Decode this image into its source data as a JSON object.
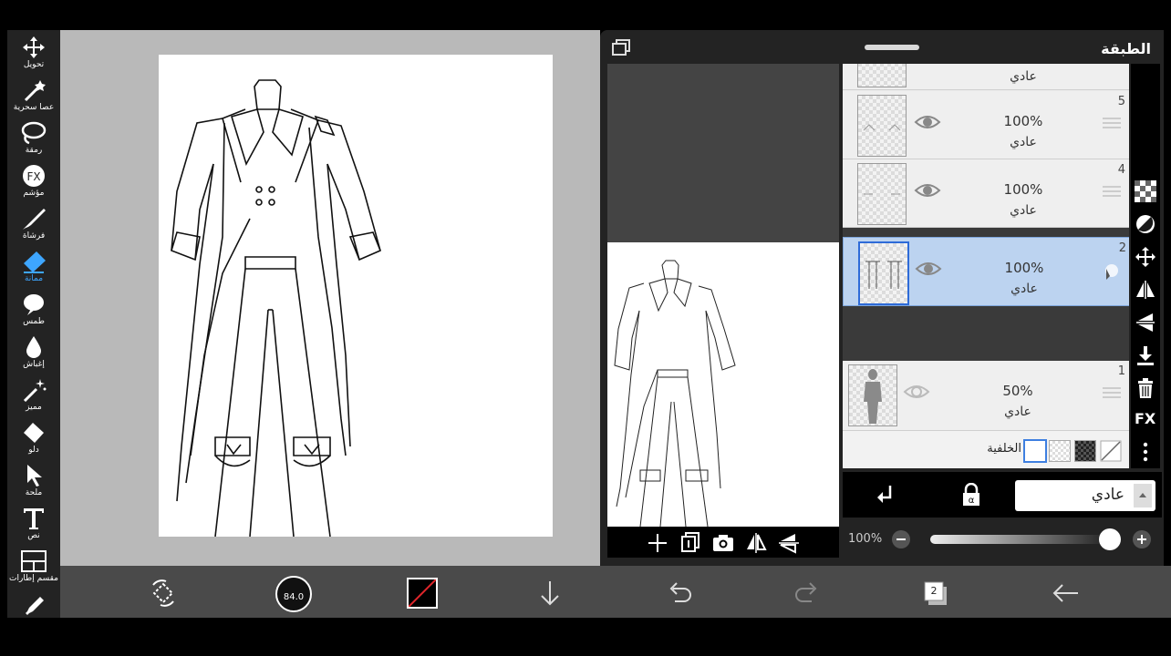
{
  "toolbar": {
    "tools": [
      {
        "label": "تحويل",
        "icon": "move-arrows-icon"
      },
      {
        "label": "عصا سحرية",
        "icon": "magic-wand-icon"
      },
      {
        "label": "رمقة",
        "icon": "lasso-icon"
      },
      {
        "label": "مؤشم",
        "icon": "fx-filter-icon"
      },
      {
        "label": "فرشاة",
        "icon": "brush-icon"
      },
      {
        "label": "ممانة",
        "icon": "eraser-icon",
        "active": true
      },
      {
        "label": "طمس",
        "icon": "smudge-icon"
      },
      {
        "label": "إغباش",
        "icon": "blur-drop-icon"
      },
      {
        "label": "مميز",
        "icon": "sparkle-wand-icon"
      },
      {
        "label": "دلو",
        "icon": "bucket-icon"
      },
      {
        "label": "ملحة",
        "icon": "select-arrow-icon"
      },
      {
        "label": "نص",
        "icon": "text-icon"
      },
      {
        "label": "مقسم إطارات",
        "icon": "frame-divider-icon"
      }
    ]
  },
  "layer_panel": {
    "title": "الطبقة",
    "layers": [
      {
        "number": "",
        "opacity": "",
        "blend": "عادي"
      },
      {
        "number": "5",
        "opacity": "100%",
        "blend": "عادي"
      },
      {
        "number": "4",
        "opacity": "100%",
        "blend": "عادي"
      },
      {
        "number": "2",
        "opacity": "100%",
        "blend": "عادي",
        "selected": true
      },
      {
        "number": "1",
        "opacity": "50%",
        "blend": "عادي"
      }
    ],
    "background_label": "الخلفية",
    "blend_mode": "عادي",
    "opacity_label": "100%",
    "opacity_value": 1.0
  },
  "bottom_bar": {
    "brush_size": "84.0",
    "layer_count": "2"
  },
  "colors": {
    "accent": "#3ea6ff",
    "selected_layer": "#bcd3f0"
  }
}
